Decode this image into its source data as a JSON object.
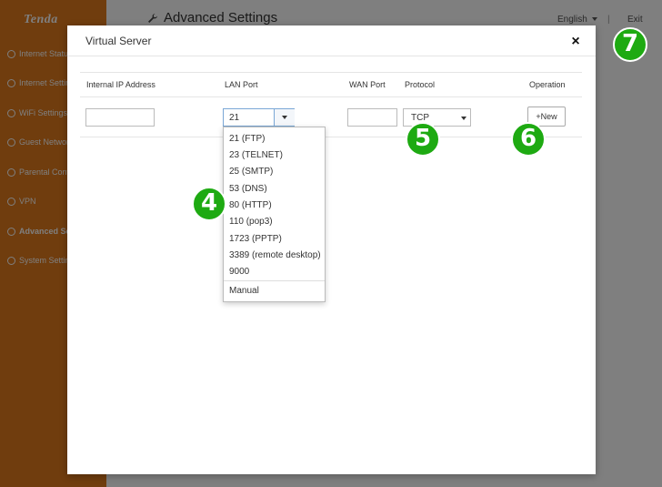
{
  "app": {
    "logo_text": "Tenda",
    "page_title": "Advanced Settings",
    "language": "English",
    "separator": "|",
    "exit_label": "Exit"
  },
  "sidebar": {
    "items": [
      {
        "label": "Internet Status",
        "icon": "status-icon"
      },
      {
        "label": "Internet Settings",
        "icon": "globe-icon"
      },
      {
        "label": "WiFi Settings",
        "icon": "wifi-icon"
      },
      {
        "label": "Guest Network",
        "icon": "guest-icon"
      },
      {
        "label": "Parental Control",
        "icon": "parental-icon"
      },
      {
        "label": "VPN",
        "icon": "vpn-icon"
      },
      {
        "label": "Advanced Settings",
        "icon": "advanced-icon",
        "active": true
      },
      {
        "label": "System Settings",
        "icon": "system-icon"
      }
    ]
  },
  "modal": {
    "title": "Virtual Server",
    "close_label": "×",
    "columns": {
      "ip": "Internal IP Address",
      "lan": "LAN Port",
      "wan": "WAN Port",
      "protocol": "Protocol",
      "operation": "Operation"
    },
    "row": {
      "ip_value": "",
      "lan_value": "21",
      "wan_value": "",
      "protocol_value": "TCP",
      "new_label": "+New"
    },
    "lan_options": [
      "21 (FTP)",
      "23 (TELNET)",
      "25 (SMTP)",
      "53 (DNS)",
      "80 (HTTP)",
      "110 (pop3)",
      "1723 (PPTP)",
      "3389 (remote desktop)",
      "9000",
      "Manual"
    ]
  },
  "steps": [
    "4",
    "5",
    "6",
    "7"
  ],
  "colors": {
    "sidebar": "#e07a1c",
    "step_marker": "#1eaa12",
    "overlay": "rgba(0,0,0,0.5)"
  }
}
